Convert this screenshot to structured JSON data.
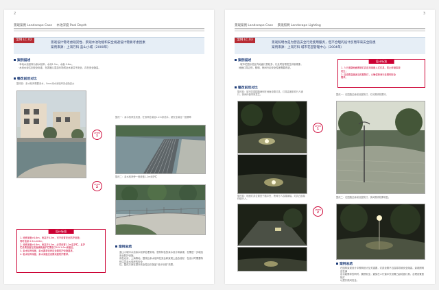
{
  "left": {
    "page_number": "2",
    "header": {
      "section": "景观案例 Landscape Case",
      "topic": "水池深度 Pool Depth"
    },
    "case_code": "案例 LC.02",
    "case_title_1": "景观设计需考虑观赏性、景观水池功能和安全规避设计需要考虑因素",
    "case_title_2": "案例来源：上海万科 蓝山小城（2000年）",
    "overview_heading": "案例描述",
    "overview_text": [
      "· 本地水池驳岸为亲水驳岸，水深1.2m，水面 0.6m。",
      "· 水池水深达到安全标准，在赛格儿童游乐场附近水深并不安全，存在安全隐患。"
    ],
    "compare_heading": "整改前后对比",
    "cap_before": "整改前：亲水驳岸需要亲水，Smm深水池驳岸安全隐患大",
    "cap_after1": "整改一：亲水驳岸处改造，在驳岸处增加1.2m深池水，使安全增加一层屏障",
    "cap_after2": "整改二：亲水驳岸旁一侧改做1.2m深护栏",
    "after1": {
      "t": "AFTER",
      "n": "1"
    },
    "after2": {
      "t": "AFTER",
      "n": "2"
    },
    "design_title": "设计标准",
    "design_items": [
      "1. 池底深度>0.6m、而高于0.5m，可不设置安全防护设施；",
      "   同时池深  0.5m-0.8m；",
      "2. 池底深度>0.6m、而高于0.5m，必须设置1.2m高护栏，且护",
      "   栏设置高度在底面铺装面护栏需高于0.9-1.0m深度区。",
      "3. 亲水驳岸深度，亲水要求驳岸应设置防护设施要求。",
      "4. 临水驳岸深度，亲水深度应设置深度防护要求。"
    ],
    "summary_heading": "案例总结",
    "summary_text": [
      "蓝山小城中水池亲水驳岸处理采用，很有特色的亲水设计和景观，但需进一步增加安全防护设施。",
      "而在北京、上海等地，整改后亲水驳岸在安全和景观上结合较好，在设计时需要特别注意亲水驳岸的安全",
      "性。整改方案在提升安全性后仍保留“设计标准”效果。"
    ]
  },
  "right": {
    "page_number": "3",
    "header": {
      "section": "景观案例 Landscape Case",
      "topic": "景观照明 Landscape Lighting"
    },
    "case_code": "案例 LC.03",
    "case_title_1": "景观照明亦是为营造安全行走使用服务，但不合理的设计反而带来安全隐患",
    "case_title_2": "案例来源：上海万科 城市花园管理中心（2004年）",
    "overview_heading": "案例描述",
    "overview_text": [
      "· 城市花园示范区内地面灯具较多，行走时容易发生绊倒现象，",
      "  地面灯具过低，照明、夜间行走安全性差需要改进。"
    ],
    "design_title": "设计标准",
    "design_items": [
      "1. 人行道路地面照明灯具应采用嵌入式灯具，防止绊倒事故",
      "   发生；",
      "2. 应设置高度适当的庭院灯，以确保夜间行走照明安全",
      "   需求。"
    ],
    "compare_heading": "整改前后对比",
    "cap_before": "整改前：城市花园园路两侧在地面设置灯具，灯具高度影响行人通行，夜间绊倒事故发生。",
    "cap_after1": "整改一：在园路边缘增设庭院灯，灯光照明效果好。",
    "cap_before2": "整改前：地面灯具位置处于路中央，夜间行人容易踩踏，灯具凸起易绊倒行人。",
    "cap_after2": "整改二：在园路边缘增设庭院灯，夜间照明效果明显。",
    "after1": {
      "t": "AFTER",
      "n": "1"
    },
    "after2": {
      "t": "AFTER",
      "n": "2"
    },
    "summary_heading": "案例总结",
    "summary_text": [
      "在园林景观设计中照明设计至关重要，灯具设置不当容易导致安全隐患。景观照明应在满",
      "足功能需求的同时，兼顾安全，避免在人行道中央设置凸起地面灯具，合理设置庭院灯",
      "以提升夜间安全。"
    ]
  }
}
